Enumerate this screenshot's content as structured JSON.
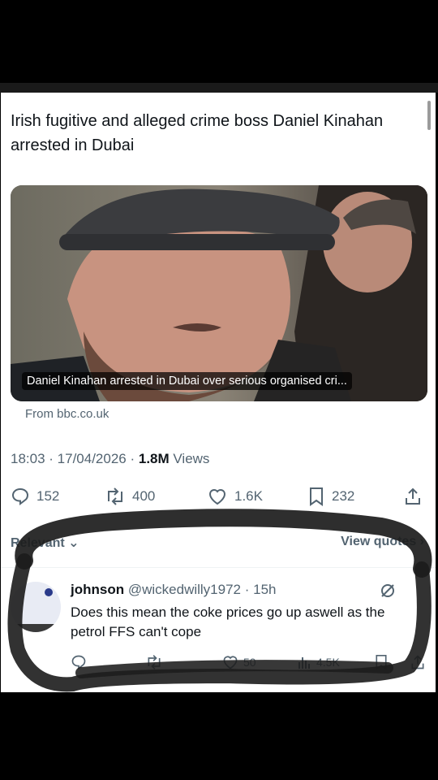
{
  "post": {
    "headline": "Irish fugitive and alleged crime boss Daniel Kinahan arrested in Dubai",
    "card_caption": "Daniel Kinahan arrested in Dubai over serious organised cri...",
    "source": "From bbc.co.uk",
    "time": "18:03",
    "date": "17/04/2026",
    "views_count": "1.8M",
    "views_label": "Views",
    "replies": "152",
    "reposts": "400",
    "likes": "1.6K",
    "bookmarks": "232"
  },
  "tabs": {
    "left": "Relevant",
    "right": "View quotes"
  },
  "reply": {
    "name": "johnson",
    "handle": "@wickedwilly1972",
    "age": "15h",
    "text": "Does this mean the coke prices go up aswell as the petrol FFS can't cope",
    "reposts": "",
    "likes": "50",
    "views": "4.5K"
  },
  "colors": {
    "muted": "#536471",
    "text": "#0f1419",
    "scribble": "#1c1c1c"
  }
}
